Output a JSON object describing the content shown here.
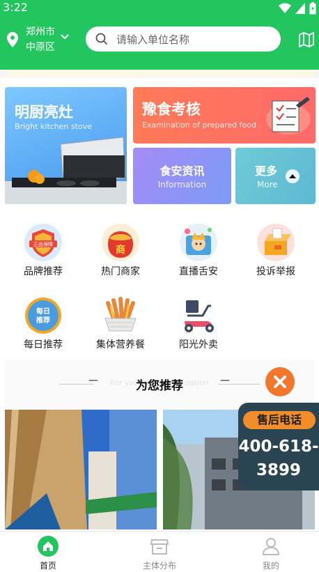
{
  "status": {
    "time": "3:22"
  },
  "header": {
    "city": "郑州市",
    "district": "中原区",
    "search_placeholder": "请输入单位名称"
  },
  "banners": [
    {
      "title": "明厨亮灶",
      "subtitle": "Bright kitchen stove"
    },
    {
      "title": "豫食考核",
      "subtitle": "Examination of prepared food"
    },
    {
      "title": "食安资讯",
      "subtitle": "Information"
    },
    {
      "title": "更多",
      "subtitle": "More"
    }
  ],
  "grid": [
    {
      "label": "品牌推荐",
      "icon": "brand-shield-icon"
    },
    {
      "label": "热门商家",
      "icon": "hot-merchant-icon"
    },
    {
      "label": "直播舌安",
      "icon": "live-stream-icon"
    },
    {
      "label": "投诉举报",
      "icon": "complaint-box-icon"
    },
    {
      "label": "每日推荐",
      "icon": "daily-recommend-icon",
      "badge_line1": "每日",
      "badge_line2": "推荐"
    },
    {
      "label": "集体营养餐",
      "icon": "group-meal-icon"
    },
    {
      "label": "阳光外卖",
      "icon": "delivery-scooter-icon"
    }
  ],
  "grid_badges": {
    "brand": "正品保障",
    "merchant": "商"
  },
  "recommend": {
    "title": "为您推荐",
    "subtitle_en": "For you Recommendation",
    "dash_left": "—",
    "dash_right": "—"
  },
  "hotline": {
    "label": "售后电话",
    "number_line1": "400-618-",
    "number_line2": "3899"
  },
  "tabs": [
    {
      "label": "首页",
      "active": true
    },
    {
      "label": "主体分布",
      "active": false
    },
    {
      "label": "我的",
      "active": false
    }
  ],
  "colors": {
    "primary": "#22c55e",
    "orange": "#f18d2a",
    "close": "#f2772c"
  }
}
